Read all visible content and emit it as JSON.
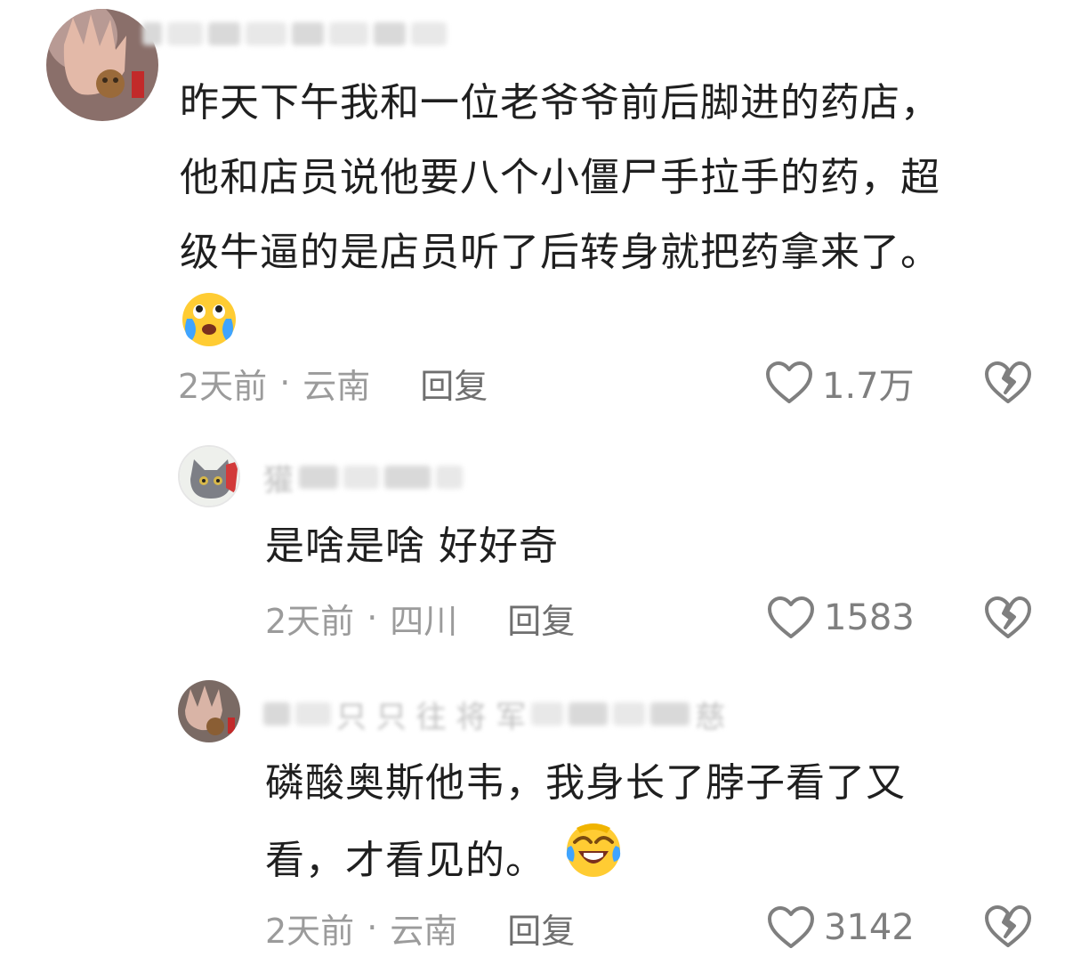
{
  "comments": [
    {
      "text_lines": [
        "昨天下午我和一位老爷爷前后脚进的药店，",
        "他和店员说他要八个小僵尸手拉手的药，超",
        "级牛逼的是店员听了后转身就把药拿来了。"
      ],
      "emoji": "crying-face-emoji",
      "time": "2天前",
      "location": "云南",
      "reply_label": "回复",
      "likes": "1.7万"
    },
    {
      "username_visible": "獾",
      "text_lines": [
        "是啥是啥 好好奇"
      ],
      "time": "2天前",
      "location": "四川",
      "reply_label": "回复",
      "likes": "1583"
    },
    {
      "username_visible": "只 只 往 将 军",
      "username_end": "慈",
      "text_lines": [
        "磷酸奥斯他韦，我身长了脖子看了又",
        "看，才看见的。"
      ],
      "emoji": "laughing-tears-emoji",
      "time": "2天前",
      "location": "云南",
      "reply_label": "回复",
      "likes": "3142"
    }
  ],
  "separator": "·",
  "icons": {
    "like": "heart-outline-icon",
    "dislike": "broken-heart-icon"
  },
  "colors": {
    "text": "#1f1f1f",
    "meta": "#9b9b9b",
    "icon": "#7f7f7f"
  }
}
